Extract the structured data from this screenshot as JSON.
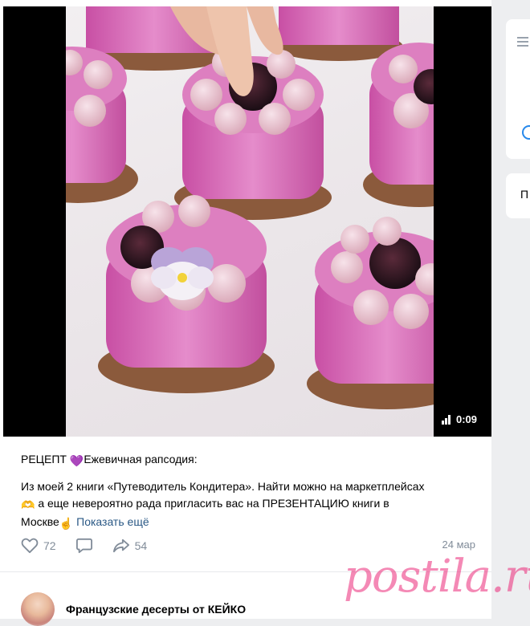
{
  "video": {
    "duration": "0:09"
  },
  "post": {
    "caption_prefix": "РЕЦЕПТ",
    "caption_heart": "💜",
    "caption_title": "Ежевичная рапсодия:",
    "text_line1": "Из моей 2 книги «Путеводитель Кондитера». Найти можно на маркетплейсах",
    "emoji_hands": "🫶",
    "text_line2": "а еще невероятно рада пригласить вас на ПРЕЗЕНТАЦИЮ книги в",
    "text_line3": "Москве",
    "emoji_point": "☝",
    "show_more": "Показать ещё",
    "likes": "72",
    "reposts": "54",
    "date": "24 мар"
  },
  "author": {
    "name": "Французские десерты от КЕЙКО"
  },
  "sidebar": {
    "label_partial": "П"
  },
  "watermark": "postila.ru",
  "colors": {
    "link": "#2a5885",
    "muted": "#818c99",
    "cake_pink": "#d86fb8",
    "watermark": "#eb2878"
  }
}
